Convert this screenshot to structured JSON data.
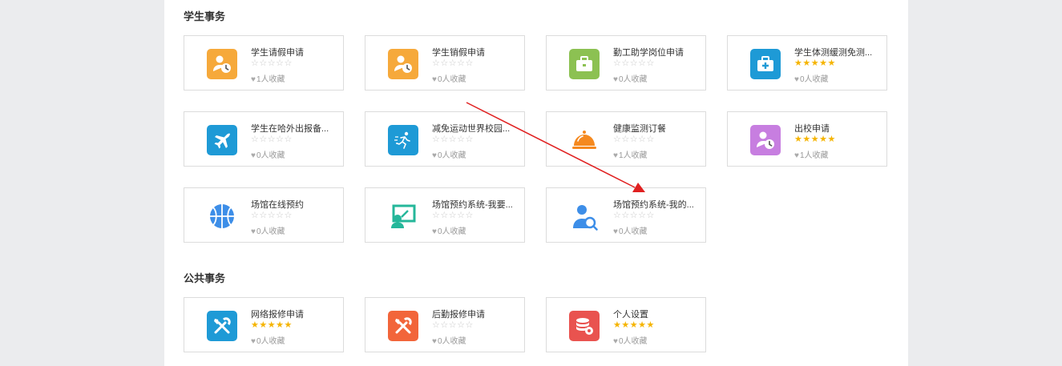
{
  "colors": {
    "background": "#ebecee",
    "panel": "#ffffff",
    "star_filled": "#f5b400",
    "star_empty": "#c8c8c8",
    "annotation_arrow": "#e02020"
  },
  "sections": [
    {
      "title": "学生事务",
      "cards": [
        {
          "name": "学生请假申请",
          "rating": 0,
          "fav": "1人收藏",
          "icon": "person-clock-icon",
          "color": "#f6a93b"
        },
        {
          "name": "学生销假申请",
          "rating": 0,
          "fav": "0人收藏",
          "icon": "person-clock-icon",
          "color": "#f6a93b"
        },
        {
          "name": "勤工助学岗位申请",
          "rating": 0,
          "fav": "0人收藏",
          "icon": "briefcase-icon",
          "color": "#8cc152"
        },
        {
          "name": "学生体测缓测免测...",
          "rating": 5,
          "fav": "0人收藏",
          "icon": "medical-kit-icon",
          "color": "#1e9ad6"
        },
        {
          "name": "学生在哈外出报备...",
          "rating": 0,
          "fav": "0人收藏",
          "icon": "airplane-icon",
          "color": "#1e9ad6"
        },
        {
          "name": "减免运动世界校园...",
          "rating": 0,
          "fav": "0人收藏",
          "icon": "runner-icon",
          "color": "#1e9ad6"
        },
        {
          "name": "健康监测订餐",
          "rating": 0,
          "fav": "1人收藏",
          "icon": "food-cloche-icon",
          "color": "#f5891f"
        },
        {
          "name": "出校申请",
          "rating": 5,
          "fav": "1人收藏",
          "icon": "person-clock-icon",
          "color": "#c77ee0"
        },
        {
          "name": "场馆在线预约",
          "rating": 0,
          "fav": "0人收藏",
          "icon": "basketball-icon",
          "color": "#3d8ee8"
        },
        {
          "name": "场馆预约系统-我要...",
          "rating": 0,
          "fav": "0人收藏",
          "icon": "presentation-icon",
          "color": "#25b79a"
        },
        {
          "name": "场馆预约系统-我的...",
          "rating": 0,
          "fav": "0人收藏",
          "icon": "user-search-icon",
          "color": "#3d8ee8"
        }
      ]
    },
    {
      "title": "公共事务",
      "cards": [
        {
          "name": "网络报修申请",
          "rating": 5,
          "fav": "0人收藏",
          "icon": "wrench-tools-icon",
          "color": "#1e9ad6"
        },
        {
          "name": "后勤报修申请",
          "rating": 0,
          "fav": "0人收藏",
          "icon": "wrench-tools-icon",
          "color": "#f2653a"
        },
        {
          "name": "个人设置",
          "rating": 5,
          "fav": "0人收藏",
          "icon": "database-settings-icon",
          "color": "#e9534f"
        }
      ]
    }
  ]
}
